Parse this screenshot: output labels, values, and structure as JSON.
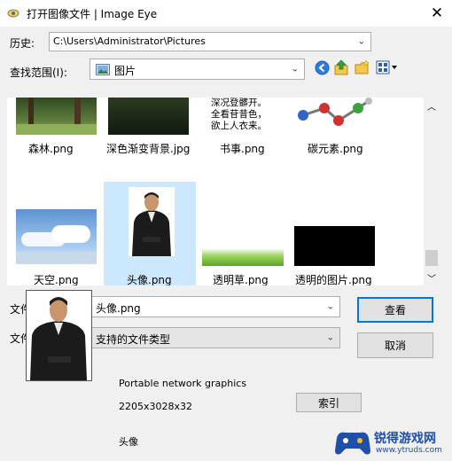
{
  "window": {
    "title": "打开图像文件 | Image Eye",
    "close_glyph": "✕"
  },
  "history": {
    "label": "历史:",
    "value": "C:\\Users\\Administrator\\Pictures"
  },
  "lookin": {
    "label": "查找范围(I):",
    "value": "图片"
  },
  "files": [
    {
      "name": "森林.png"
    },
    {
      "name": "深色渐变背景.jpg"
    },
    {
      "name": "书事.png"
    },
    {
      "name": "碳元素.png"
    },
    {
      "name": "天空.png"
    },
    {
      "name": "头像.png"
    },
    {
      "name": "透明草.png"
    },
    {
      "name": "透明的图片.png"
    }
  ],
  "thumb_text": {
    "book": [
      "深况登髒开。",
      "全看苷昔色，",
      "欲上人衣来。"
    ]
  },
  "filename": {
    "label": "文件名(N):",
    "value": "头像.png"
  },
  "filetype": {
    "label": "文件类型(T):",
    "value": "支持的文件类型"
  },
  "buttons": {
    "open": "查看",
    "cancel": "取消",
    "index": "索引"
  },
  "info": {
    "format": "Portable network graphics",
    "dimensions": "2205x3028x32",
    "name": "头像"
  },
  "watermark": {
    "brand": "锐得游戏网",
    "url": "www.ytruds.com"
  },
  "colors": {
    "selection": "#cce8ff",
    "accent": "#0078d7"
  }
}
